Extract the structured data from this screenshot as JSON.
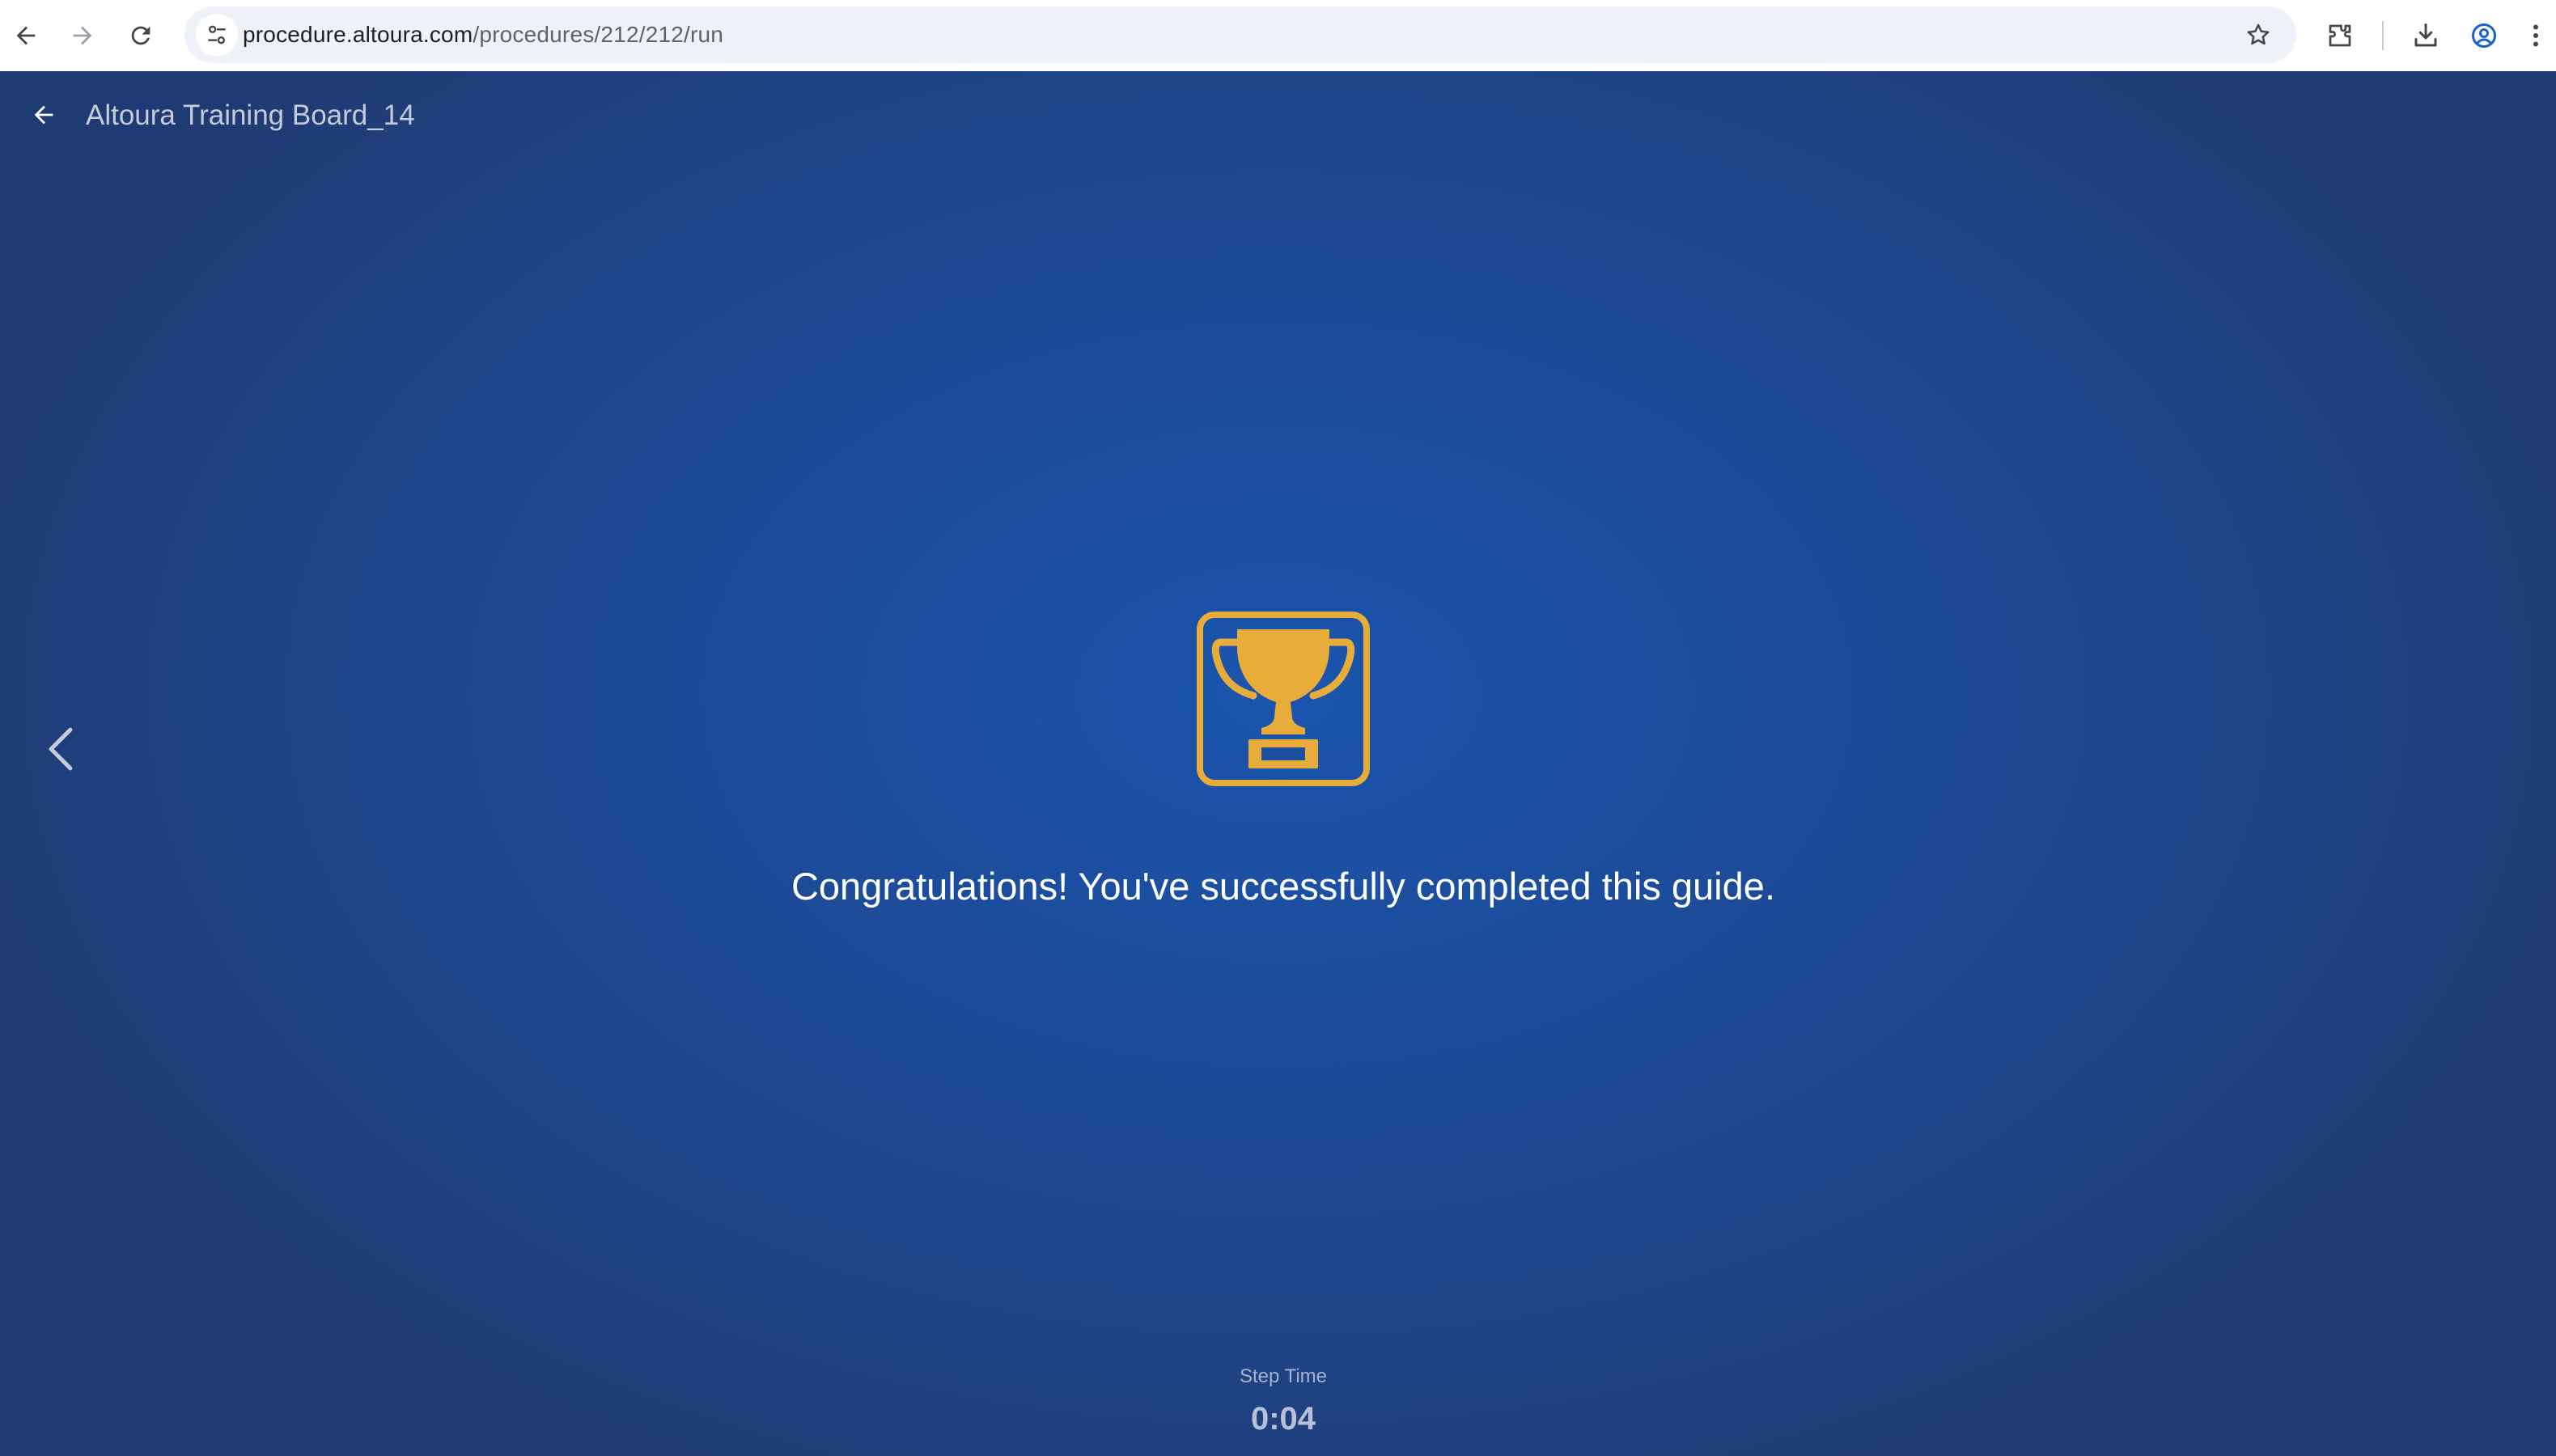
{
  "browser": {
    "url_host": "procedure.altoura.com",
    "url_path": "/procedures/212/212/run",
    "icons": {
      "back": "arrow-left-icon",
      "forward": "arrow-right-icon",
      "reload": "reload-icon",
      "site_info": "tune-icon",
      "bookmark": "star-icon",
      "extensions": "puzzle-icon",
      "downloads": "download-icon",
      "profile": "account-circle-icon",
      "menu": "more-vert-icon"
    }
  },
  "app": {
    "title": "Altoura Training Board_14",
    "message": "Congratulations! You've successfully completed this guide.",
    "step_time_label": "Step Time",
    "step_time_value": "0:04",
    "colors": {
      "background": "#1a55ad",
      "trophy": "#e8ac3a",
      "text": "#ffffff"
    }
  }
}
